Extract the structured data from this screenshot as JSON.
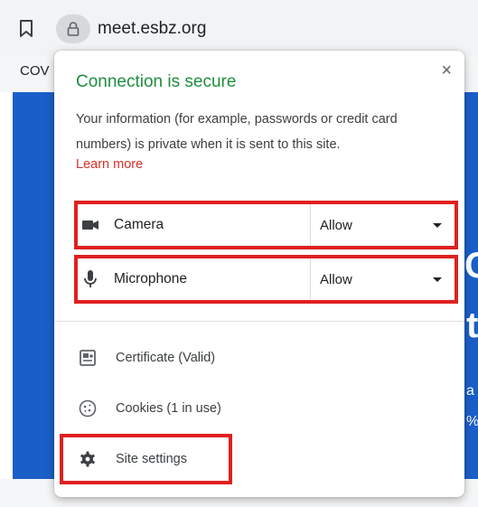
{
  "browser": {
    "url": "meet.esbz.org",
    "page_partial_text": "COV",
    "page_glyphs": [
      "C",
      "t",
      "a",
      "%"
    ]
  },
  "popup": {
    "title": "Connection is secure",
    "description": "Your information (for example, passwords or credit card numbers) is private when it is sent to this site.",
    "learn_more": "Learn more",
    "close_label": "×",
    "permissions": [
      {
        "label": "Camera",
        "value": "Allow",
        "icon": "camera-icon"
      },
      {
        "label": "Microphone",
        "value": "Allow",
        "icon": "microphone-icon"
      }
    ],
    "items": [
      {
        "label": "Certificate (Valid)",
        "icon": "certificate-icon"
      },
      {
        "label": "Cookies (1 in use)",
        "icon": "cookie-icon"
      },
      {
        "label": "Site settings",
        "icon": "gear-icon"
      }
    ]
  },
  "colors": {
    "secure_green": "#1e8e3e",
    "link_red": "#d93025",
    "highlight_red": "#e02020",
    "page_blue": "#1a5fc8"
  }
}
